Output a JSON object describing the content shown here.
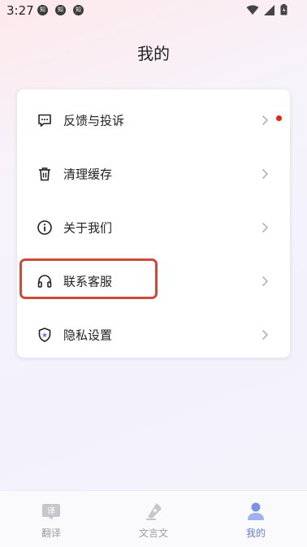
{
  "status_bar": {
    "time": "3:27",
    "notifications": [
      {
        "icon": "app-notification-icon",
        "text": "知"
      },
      {
        "icon": "app-notification-icon",
        "text": "知"
      },
      {
        "icon": "app-notification-icon",
        "text": "知"
      }
    ],
    "icons": [
      "wifi-icon",
      "signal-icon",
      "battery-icon"
    ]
  },
  "page": {
    "title": "我的"
  },
  "menu": {
    "items": [
      {
        "label": "反馈与投诉",
        "icon": "feedback-chat-icon",
        "badge": "red-dot"
      },
      {
        "label": "清理缓存",
        "icon": "trash-icon"
      },
      {
        "label": "关于我们",
        "icon": "info-icon"
      },
      {
        "label": "联系客服",
        "icon": "headphones-icon",
        "highlighted": true
      },
      {
        "label": "隐私设置",
        "icon": "shield-icon"
      }
    ],
    "highlight_color": "#cc4a3a",
    "badge_color": "#e2231a"
  },
  "tab_bar": {
    "tabs": [
      {
        "label": "翻译",
        "icon": "translate-icon",
        "icon_text": "译"
      },
      {
        "label": "文言文",
        "icon": "classical-chinese-icon"
      },
      {
        "label": "我的",
        "icon": "profile-icon",
        "active": true
      }
    ],
    "active_color": "#6a7ec8",
    "inactive_color": "#9a9aa6"
  }
}
